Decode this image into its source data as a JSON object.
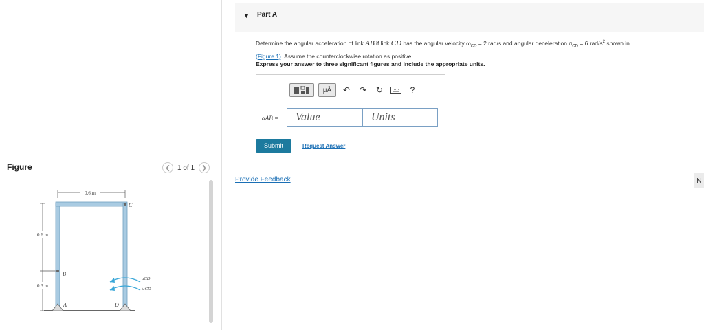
{
  "figure_panel": {
    "title": "Figure",
    "pager_text": "1 of 1",
    "prev_icon": "chevron-left-icon",
    "next_icon": "chevron-right-icon",
    "diagram": {
      "dim_top": "0.6 m",
      "dim_left_upper": "0.6 m",
      "dim_left_lower": "0.3 m",
      "point_a": "A",
      "point_b": "B",
      "point_c": "C",
      "point_d": "D",
      "alpha_label": "αCD",
      "omega_label": "ωCD",
      "link_color": "#a9cbe2",
      "arrow_color": "#3aa7d8"
    }
  },
  "part": {
    "toggle_icon": "triangle-down-icon",
    "label": "Part A",
    "q_1": "Determine the angular acceleration of link ",
    "q_ab": "AB",
    "q_2": " if link ",
    "q_cd": "CD",
    "q_3": " has the angular velocity ω",
    "q_sub_cd1": "CD",
    "q_4": " = 2 rad/s and angular deceleration α",
    "q_sub_cd2": "CD",
    "q_5": " = 6 rad/s",
    "q_sup": "2",
    "q_6": " shown in",
    "q_link": "(Figure 1)",
    "q_7": ". Assume the counterclockwise rotation as positive.",
    "instructions": "Express your answer to three significant figures and include the appropriate units."
  },
  "answer": {
    "toolbar": {
      "template_icon": "fraction-template-icon",
      "units_button": "μÅ",
      "undo_icon": "undo-icon",
      "redo_icon": "redo-icon",
      "reset_icon": "reset-icon",
      "keyboard_icon": "keyboard-icon",
      "help": "?"
    },
    "variable_label": "αAB =",
    "value_placeholder": "Value",
    "units_placeholder": "Units",
    "submit": "Submit",
    "request": "Request Answer"
  },
  "footer": {
    "feedback": "Provide Feedback",
    "next": "N"
  },
  "colors": {
    "accent": "#1c7a9e",
    "link": "#1a6fb5"
  }
}
